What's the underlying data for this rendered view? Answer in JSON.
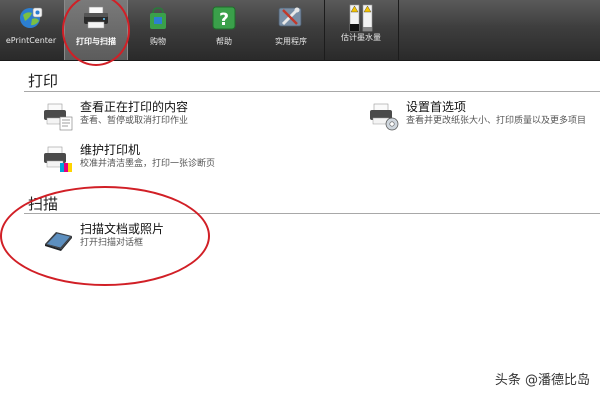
{
  "toolbar": {
    "items": [
      {
        "label": "ePrintCenter",
        "icon": "eprint-globe-icon"
      },
      {
        "label": "打印与扫描",
        "icon": "printer-icon"
      },
      {
        "label": "购物",
        "icon": "shopping-bag-icon"
      },
      {
        "label": "帮助",
        "icon": "help-icon"
      },
      {
        "label": "实用程序",
        "icon": "tools-icon"
      },
      {
        "label": "估计墨水量",
        "icon": "ink-level-icon"
      }
    ],
    "active_index": 1
  },
  "print_section": {
    "title": "打印",
    "actions": [
      {
        "title": "查看正在打印的内容",
        "desc": "查看、暂停或取消打印作业",
        "icon": "print-queue-icon"
      },
      {
        "title": "设置首选项",
        "desc": "查看并更改纸张大小、打印质量以及更多项目",
        "icon": "printer-preferences-icon"
      },
      {
        "title": "维护打印机",
        "desc": "校准并清洁墨盒，打印一张诊断页",
        "icon": "printer-maintenance-icon"
      }
    ]
  },
  "scan_section": {
    "title": "扫描",
    "actions": [
      {
        "title": "扫描文档或照片",
        "desc": "打开扫描对话框",
        "icon": "scanner-icon"
      }
    ]
  },
  "watermark": "头条 @潘德比岛",
  "colors": {
    "toolbar": "#3e3e3e",
    "annotation": "#d11f26"
  }
}
